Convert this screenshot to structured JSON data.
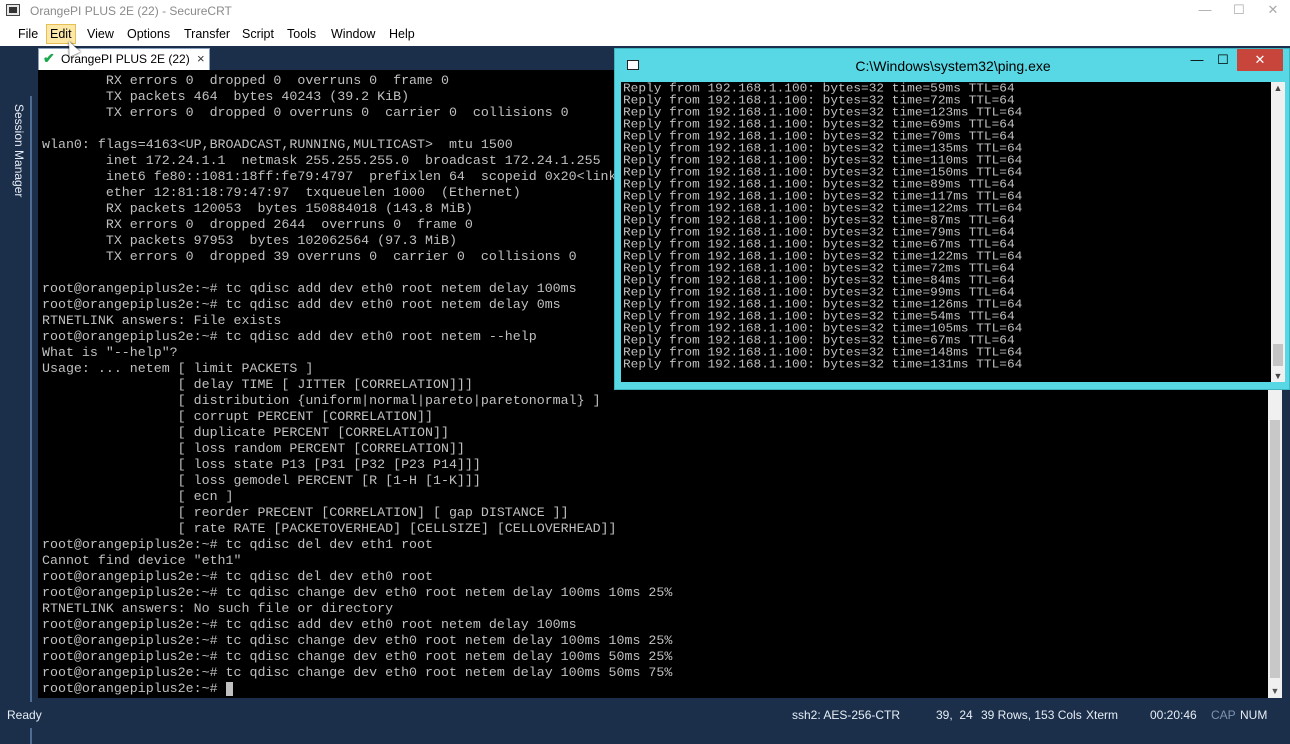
{
  "window": {
    "title": "OrangePI PLUS 2E (22) - SecureCRT",
    "min_glyph": "—",
    "max_glyph": "☐",
    "close_glyph": "✕"
  },
  "menu": {
    "items": [
      "File",
      "Edit",
      "View",
      "Options",
      "Transfer",
      "Script",
      "Tools",
      "Window",
      "Help"
    ],
    "active": "Edit"
  },
  "session_manager": {
    "label": "Session Manager"
  },
  "tab": {
    "label": "OrangePI PLUS 2E (22)",
    "close_glyph": "×",
    "status_icon": "check-icon"
  },
  "terminal": {
    "lines": [
      "        RX errors 0  dropped 0  overruns 0  frame 0",
      "        TX packets 464  bytes 40243 (39.2 KiB)",
      "        TX errors 0  dropped 0 overruns 0  carrier 0  collisions 0",
      "",
      "wlan0: flags=4163<UP,BROADCAST,RUNNING,MULTICAST>  mtu 1500",
      "        inet 172.24.1.1  netmask 255.255.255.0  broadcast 172.24.1.255",
      "        inet6 fe80::1081:18ff:fe79:4797  prefixlen 64  scopeid 0x20<link>",
      "        ether 12:81:18:79:47:97  txqueuelen 1000  (Ethernet)",
      "        RX packets 120053  bytes 150884018 (143.8 MiB)",
      "        RX errors 0  dropped 2644  overruns 0  frame 0",
      "        TX packets 97953  bytes 102062564 (97.3 MiB)",
      "        TX errors 0  dropped 39 overruns 0  carrier 0  collisions 0",
      "",
      "root@orangepiplus2e:~# tc qdisc add dev eth0 root netem delay 100ms",
      "root@orangepiplus2e:~# tc qdisc add dev eth0 root netem delay 0ms",
      "RTNETLINK answers: File exists",
      "root@orangepiplus2e:~# tc qdisc add dev eth0 root netem --help",
      "What is \"--help\"?",
      "Usage: ... netem [ limit PACKETS ]",
      "                 [ delay TIME [ JITTER [CORRELATION]]]",
      "                 [ distribution {uniform|normal|pareto|paretonormal} ]",
      "                 [ corrupt PERCENT [CORRELATION]]",
      "                 [ duplicate PERCENT [CORRELATION]]",
      "                 [ loss random PERCENT [CORRELATION]]",
      "                 [ loss state P13 [P31 [P32 [P23 P14]]]",
      "                 [ loss gemodel PERCENT [R [1-H [1-K]]]",
      "                 [ ecn ]",
      "                 [ reorder PRECENT [CORRELATION] [ gap DISTANCE ]]",
      "                 [ rate RATE [PACKETOVERHEAD] [CELLSIZE] [CELLOVERHEAD]]",
      "root@orangepiplus2e:~# tc qdisc del dev eth1 root",
      "Cannot find device \"eth1\"",
      "root@orangepiplus2e:~# tc qdisc del dev eth0 root",
      "root@orangepiplus2e:~# tc qdisc change dev eth0 root netem delay 100ms 10ms 25%",
      "RTNETLINK answers: No such file or directory",
      "root@orangepiplus2e:~# tc qdisc add dev eth0 root netem delay 100ms",
      "root@orangepiplus2e:~# tc qdisc change dev eth0 root netem delay 100ms 10ms 25%",
      "root@orangepiplus2e:~# tc qdisc change dev eth0 root netem delay 100ms 50ms 25%",
      "root@orangepiplus2e:~# tc qdisc change dev eth0 root netem delay 100ms 50ms 75%",
      "root@orangepiplus2e:~# "
    ]
  },
  "ping_window": {
    "title": "C:\\Windows\\system32\\ping.exe",
    "min_glyph": "—",
    "max_glyph": "☐",
    "close_glyph": "✕",
    "lines": [
      "Reply from 192.168.1.100: bytes=32 time=59ms TTL=64",
      "Reply from 192.168.1.100: bytes=32 time=72ms TTL=64",
      "Reply from 192.168.1.100: bytes=32 time=123ms TTL=64",
      "Reply from 192.168.1.100: bytes=32 time=69ms TTL=64",
      "Reply from 192.168.1.100: bytes=32 time=70ms TTL=64",
      "Reply from 192.168.1.100: bytes=32 time=135ms TTL=64",
      "Reply from 192.168.1.100: bytes=32 time=110ms TTL=64",
      "Reply from 192.168.1.100: bytes=32 time=150ms TTL=64",
      "Reply from 192.168.1.100: bytes=32 time=89ms TTL=64",
      "Reply from 192.168.1.100: bytes=32 time=117ms TTL=64",
      "Reply from 192.168.1.100: bytes=32 time=122ms TTL=64",
      "Reply from 192.168.1.100: bytes=32 time=87ms TTL=64",
      "Reply from 192.168.1.100: bytes=32 time=79ms TTL=64",
      "Reply from 192.168.1.100: bytes=32 time=67ms TTL=64",
      "Reply from 192.168.1.100: bytes=32 time=122ms TTL=64",
      "Reply from 192.168.1.100: bytes=32 time=72ms TTL=64",
      "Reply from 192.168.1.100: bytes=32 time=84ms TTL=64",
      "Reply from 192.168.1.100: bytes=32 time=99ms TTL=64",
      "Reply from 192.168.1.100: bytes=32 time=126ms TTL=64",
      "Reply from 192.168.1.100: bytes=32 time=54ms TTL=64",
      "Reply from 192.168.1.100: bytes=32 time=105ms TTL=64",
      "Reply from 192.168.1.100: bytes=32 time=67ms TTL=64",
      "Reply from 192.168.1.100: bytes=32 time=148ms TTL=64",
      "Reply from 192.168.1.100: bytes=32 time=131ms TTL=64"
    ]
  },
  "status_bar": {
    "ready": "Ready",
    "cipher": "ssh2: AES-256-CTR",
    "cursor_pos": "39,  24",
    "dimensions": "39 Rows, 153 Cols",
    "emulation": "Xterm",
    "time": "00:20:46",
    "cap": "CAP",
    "num": "NUM"
  },
  "colors": {
    "chrome_bg": "#1c2f4a",
    "terminal_bg": "#000000",
    "terminal_fg": "#c0c0c0",
    "ping_frame": "#58d8e4",
    "ping_close": "#c7453b",
    "menu_active": "#fde8a7"
  }
}
